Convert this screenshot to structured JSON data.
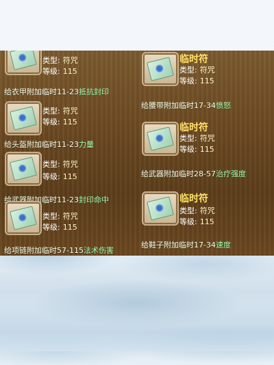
{
  "labels": {
    "type_label": "类型:",
    "level_label": "等级:"
  },
  "left_items": [
    {
      "name": "",
      "type": "符咒",
      "level": "115",
      "desc_prefix": "给衣甲附加临时",
      "desc_range": "11-23",
      "desc_attr": "抵抗封印"
    },
    {
      "name": "",
      "type": "符咒",
      "level": "115",
      "desc_prefix": "给头盔附加临时",
      "desc_range": "11-23",
      "desc_attr": "力量"
    },
    {
      "name": "",
      "type": "符咒",
      "level": "115",
      "desc_prefix": "给武器附加临时",
      "desc_range": "11-23",
      "desc_attr": "封印命中"
    },
    {
      "name": "",
      "type": "符咒",
      "level": "115",
      "desc_prefix": "给项链附加临时",
      "desc_range": "57-115",
      "desc_attr": "法术伤害"
    }
  ],
  "right_items": [
    {
      "name": "临时符",
      "type": "符咒",
      "level": "115",
      "desc_prefix": "给腰带附加临时",
      "desc_range": "17-34",
      "desc_attr": "愤怒"
    },
    {
      "name": "临时符",
      "type": "符咒",
      "level": "115",
      "desc_prefix": "给武器附加临时",
      "desc_range": "28-57",
      "desc_attr": "治疗强度"
    },
    {
      "name": "临时符",
      "type": "符咒",
      "level": "115",
      "desc_prefix": "给鞋子附加临时",
      "desc_range": "17-34",
      "desc_attr": "速度"
    }
  ]
}
